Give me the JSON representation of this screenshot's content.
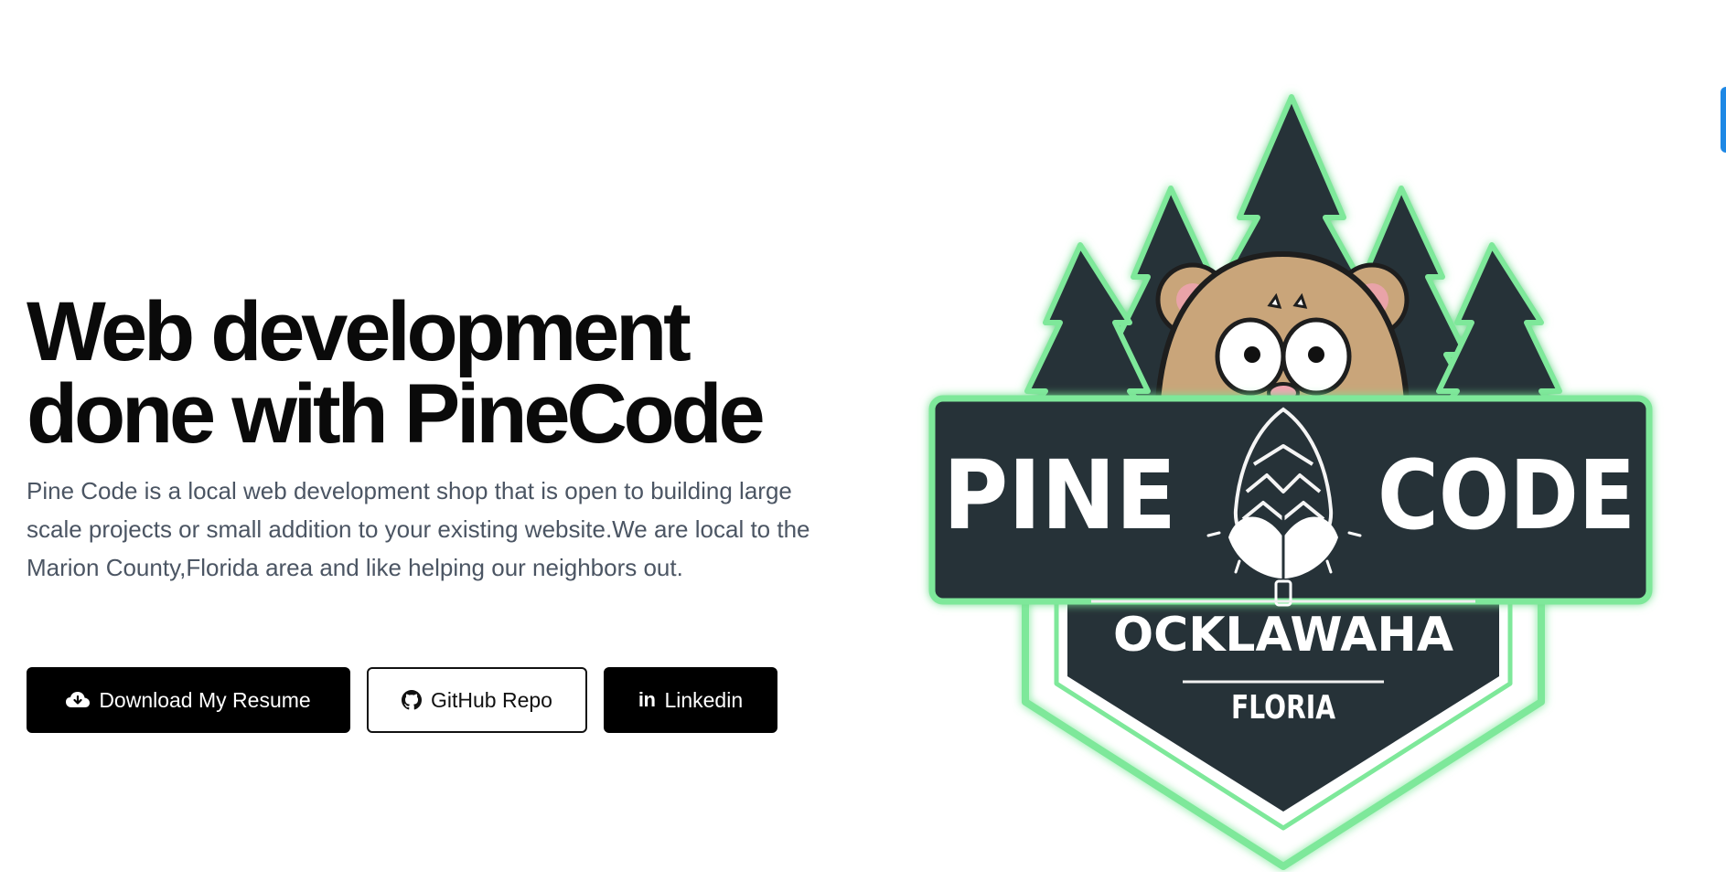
{
  "hero": {
    "title_line1": "Web development",
    "title_line2": "done with PineCode",
    "description": "Pine Code is a local web development shop that is open to building large scale projects or small addition to your existing website.We are local to the Marion County,Florida area and like helping our neighbors out."
  },
  "buttons": {
    "resume": {
      "label": "Download My Resume",
      "icon": "cloud-download-icon"
    },
    "github": {
      "label": "GitHub Repo",
      "icon": "github-icon"
    },
    "linkedin": {
      "label": "Linkedin",
      "icon": "linkedin-icon"
    }
  },
  "logo": {
    "word_left": "PINE",
    "word_right": "CODE",
    "city": "OCKLAWAHA",
    "state": "FLORIA",
    "colors": {
      "dark": "#263238",
      "glow": "#7ee89a",
      "bear": "#c9a57a"
    }
  },
  "colors": {
    "button_dark": "#000000",
    "text_muted": "#4b5563",
    "edge_tab": "#1e88e5"
  }
}
